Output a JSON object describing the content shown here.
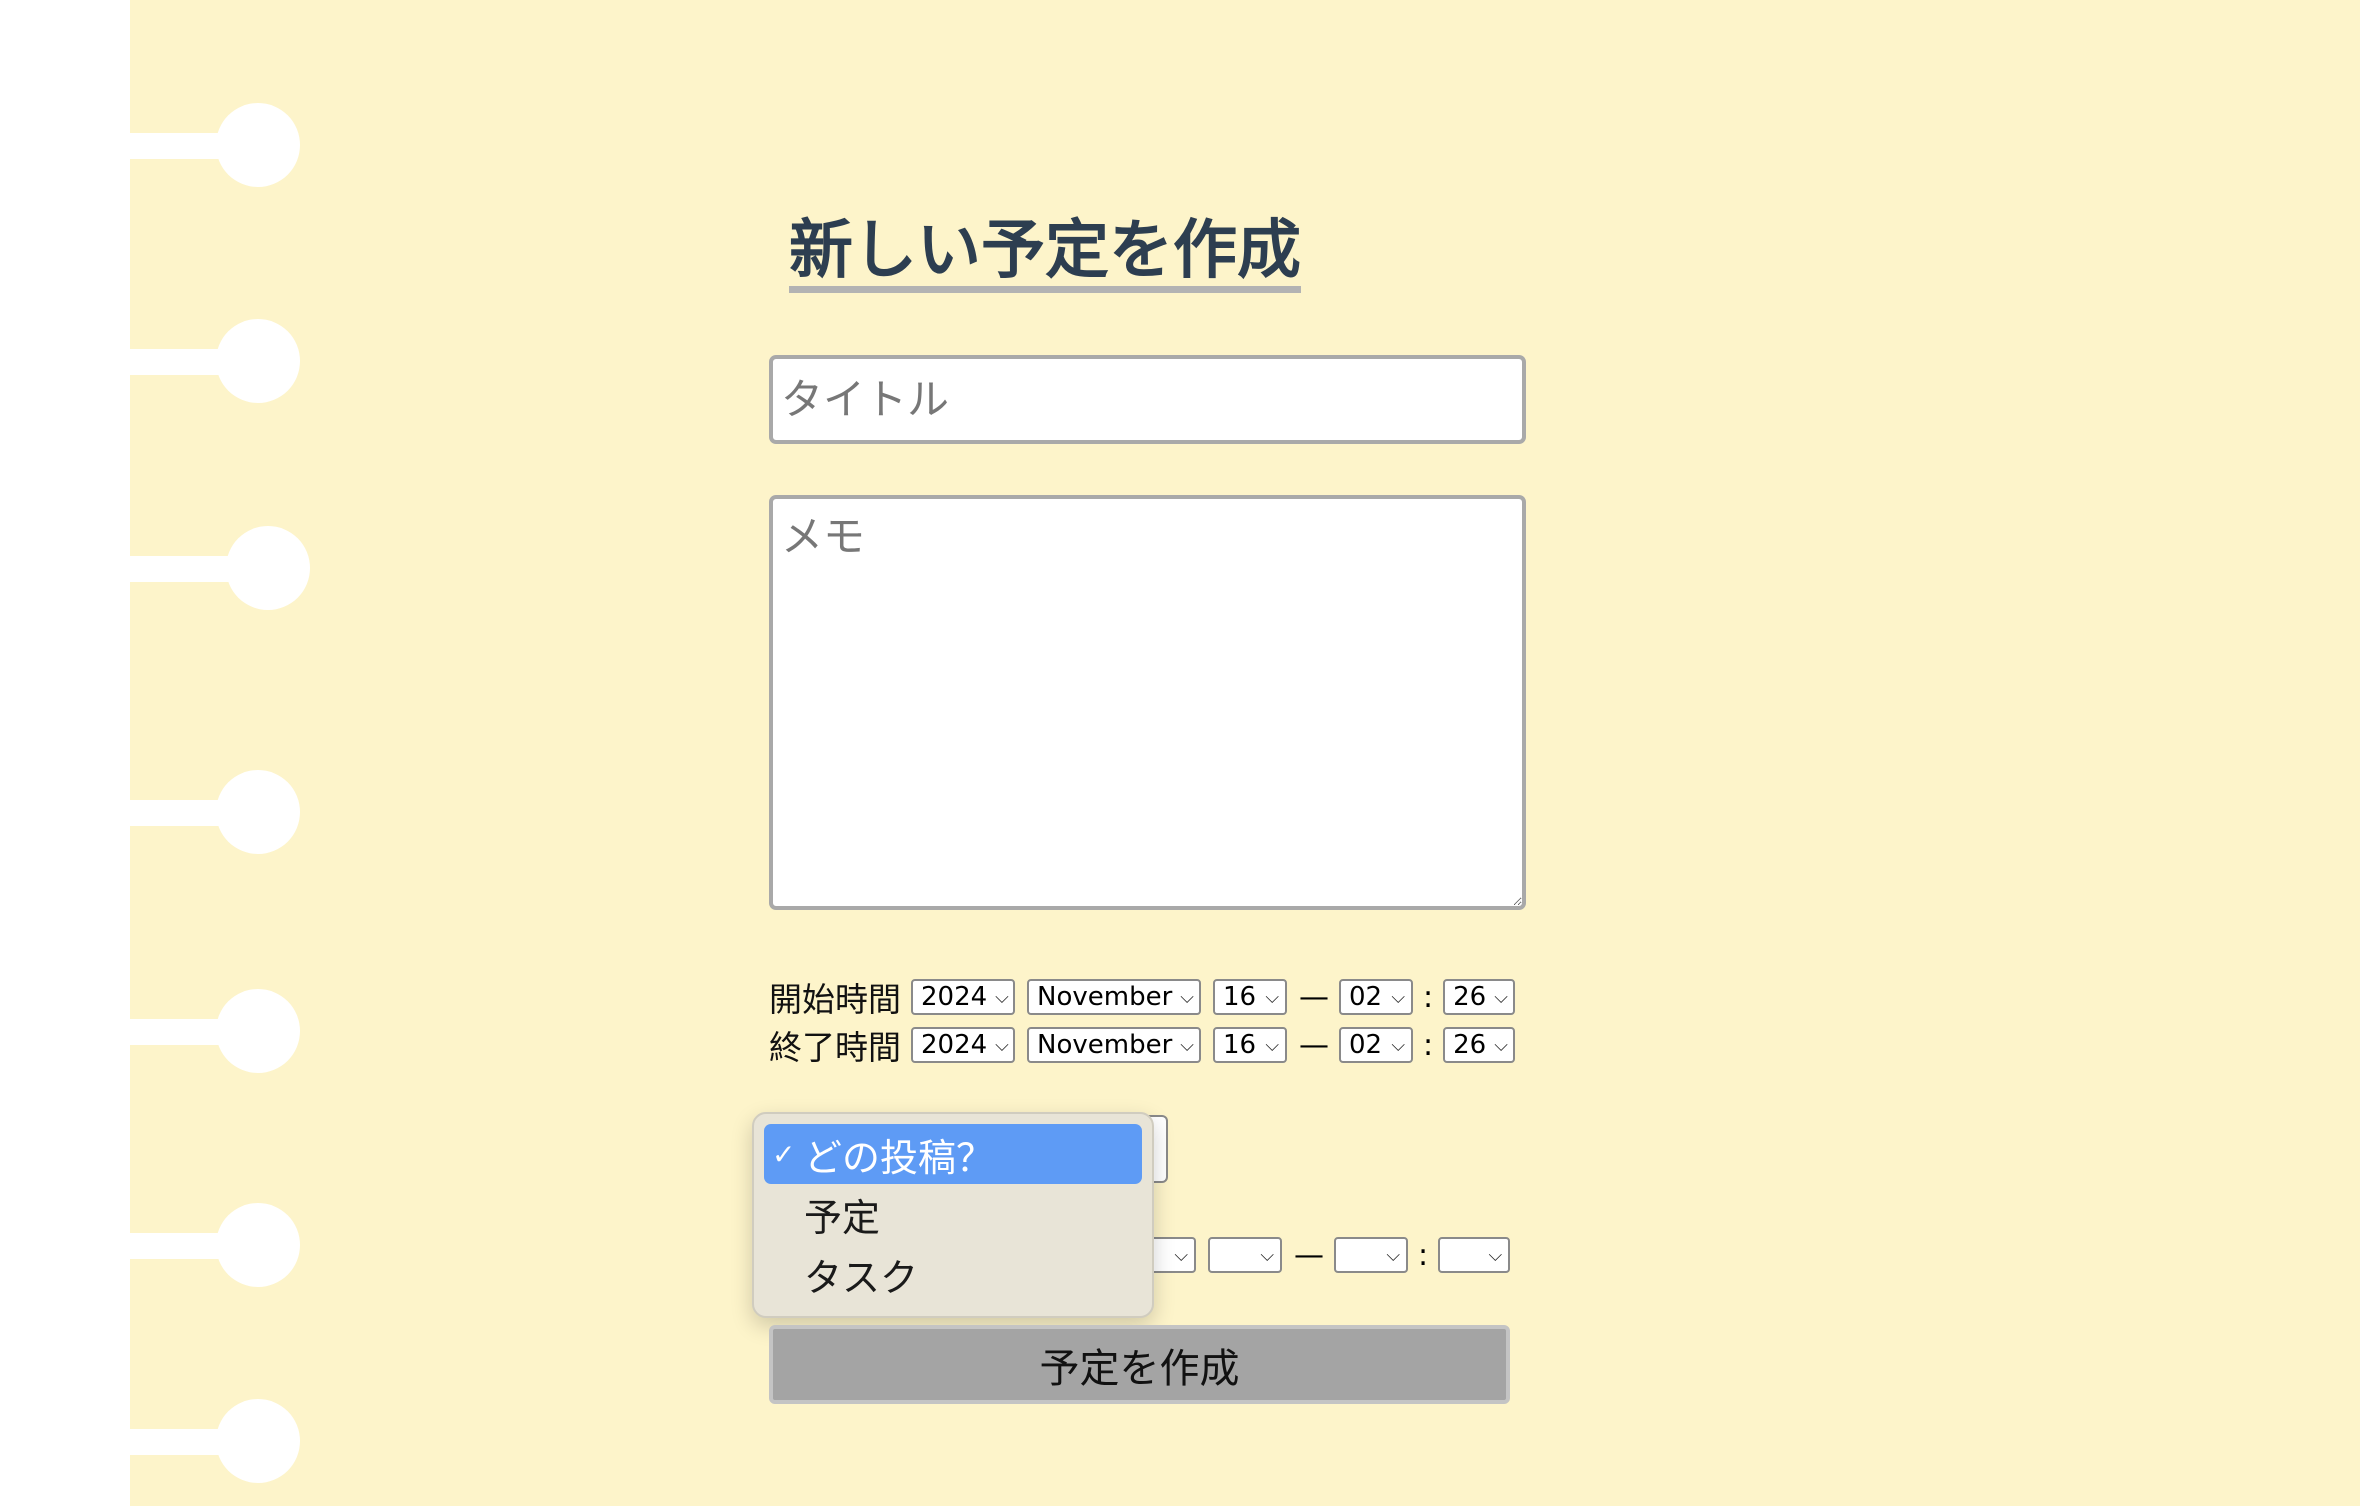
{
  "heading": "新しい予定を作成",
  "title_input": {
    "placeholder": "タイトル",
    "value": ""
  },
  "memo_input": {
    "placeholder": "メモ",
    "value": ""
  },
  "start_time": {
    "label": "開始時間",
    "year": "2024",
    "month": "November",
    "day": "16",
    "hour": "02",
    "minute": "26"
  },
  "end_time": {
    "label": "終了時間",
    "year": "2024",
    "month": "November",
    "day": "16",
    "hour": "02",
    "minute": "26"
  },
  "separators": {
    "dash": "—",
    "colon": ":"
  },
  "post_type_dropdown": {
    "check": "✓",
    "options": [
      "どの投稿？",
      "予定",
      "タスク"
    ],
    "selected_index": 0
  },
  "submit_button": "予定を作成",
  "colors": {
    "paper": "#fdf4ca",
    "heading": "#2d3e50",
    "selected_option": "#5e9bf5",
    "button": "#a4a4a4"
  },
  "icons": {
    "select_arrow": "chevron-down-icon"
  }
}
